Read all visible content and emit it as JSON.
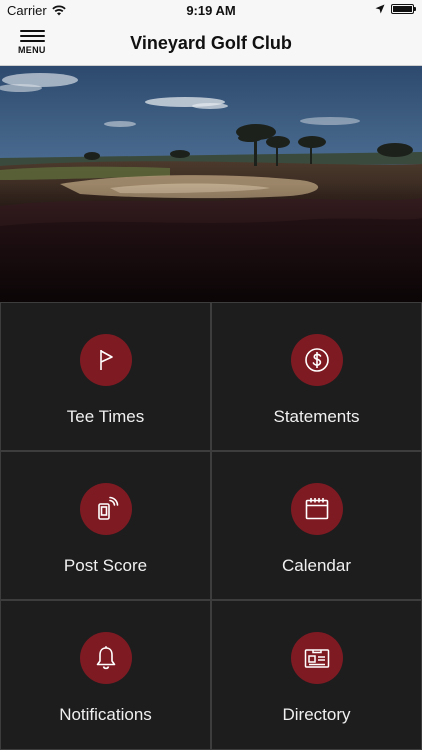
{
  "status_bar": {
    "carrier": "Carrier",
    "time": "9:19 AM"
  },
  "nav": {
    "menu_label": "MENU",
    "title": "Vineyard Golf Club"
  },
  "colors": {
    "accent": "#7e1a22",
    "tile_background": "#1e1d1e",
    "tile_border": "#3e3d3e",
    "nav_background": "#f7f7f7"
  },
  "tiles": [
    {
      "label": "Tee Times",
      "icon": "flag-icon"
    },
    {
      "label": "Statements",
      "icon": "dollar-icon"
    },
    {
      "label": "Post Score",
      "icon": "phone-signal-icon"
    },
    {
      "label": "Calendar",
      "icon": "calendar-icon"
    },
    {
      "label": "Notifications",
      "icon": "bell-icon"
    },
    {
      "label": "Directory",
      "icon": "id-card-icon"
    }
  ]
}
